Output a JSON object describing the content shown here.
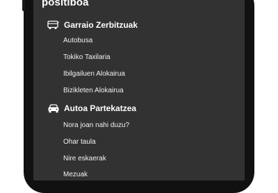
{
  "menu": {
    "title": "positiboa",
    "sections": [
      {
        "icon": "bus-icon",
        "title": "Garraio Zerbitzuak",
        "items": [
          "Autobusa",
          "Tokiko Taxilaria",
          "Ibilgailuen Alokairua",
          "Bizikleten Alokairua"
        ]
      },
      {
        "icon": "car-icon",
        "title": "Autoa Partekatzea",
        "items": [
          "Nora joan nahi duzu?",
          "Ohar taula",
          "Nire eskaerak",
          "Mezuak"
        ]
      }
    ]
  }
}
